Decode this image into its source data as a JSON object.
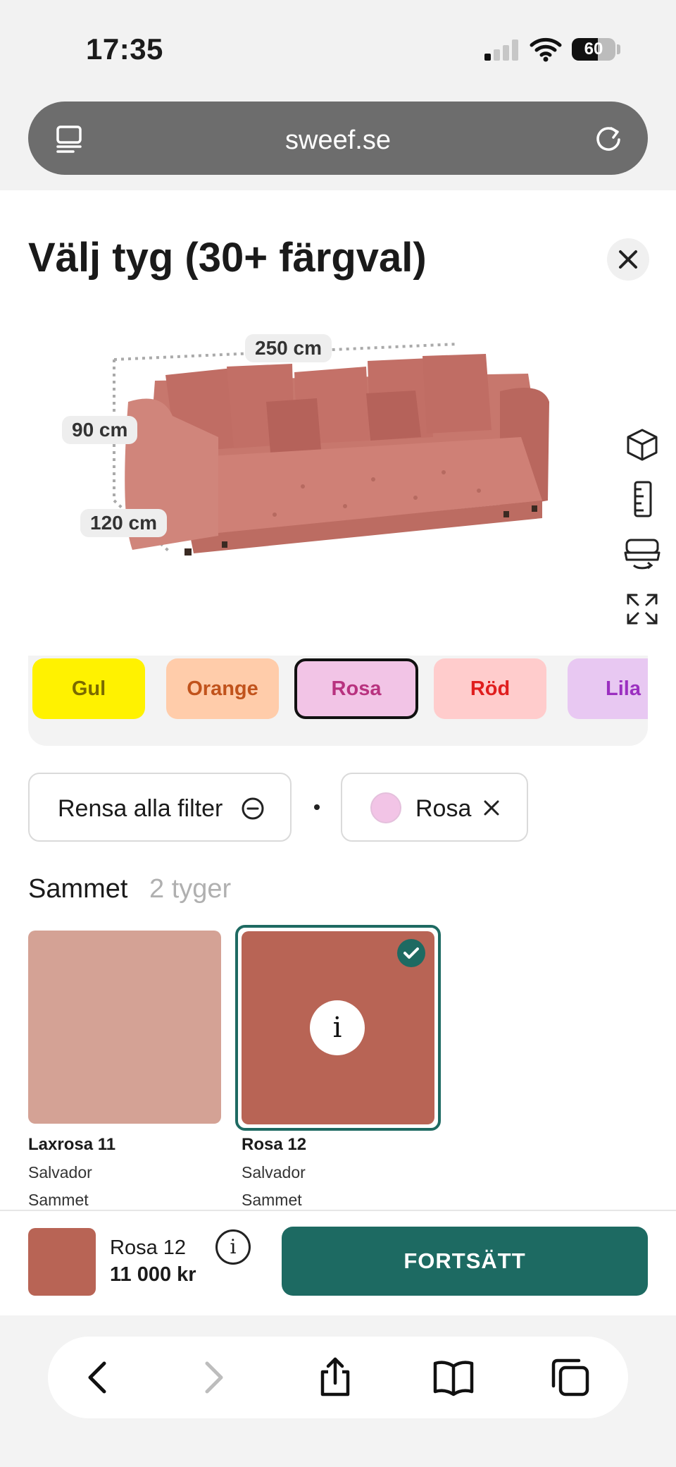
{
  "status": {
    "time": "17:35",
    "battery": "60"
  },
  "browser": {
    "url": "sweef.se"
  },
  "panel": {
    "title": "Välj tyg (30+ färgval)"
  },
  "dimensions": {
    "width": "250 cm",
    "height": "90 cm",
    "depth": "120 cm"
  },
  "colors": {
    "chips": [
      {
        "label": "Gul",
        "bg": "#fff200",
        "fg": "#7a6a00"
      },
      {
        "label": "Orange",
        "bg": "#ffccaa",
        "fg": "#c1531c"
      },
      {
        "label": "Rosa",
        "bg": "#f2c4e6",
        "fg": "#b8327f",
        "selected": true
      },
      {
        "label": "Röd",
        "bg": "#ffcccc",
        "fg": "#e01e1e"
      },
      {
        "label": "Lila",
        "bg": "#e8c8f2",
        "fg": "#9b2fc0"
      }
    ]
  },
  "filters": {
    "clear_label": "Rensa alla filter",
    "active_label": "Rosa",
    "active_color": "#f2c4e6"
  },
  "section": {
    "title": "Sammet",
    "count": "2 tyger"
  },
  "fabrics": [
    {
      "name": "Laxrosa 11",
      "collection": "Salvador",
      "material": "Sammet",
      "color": "#d4a295",
      "selected": false
    },
    {
      "name": "Rosa 12",
      "collection": "Salvador",
      "material": "Sammet",
      "color": "#b86455",
      "selected": true
    }
  ],
  "selection": {
    "name": "Rosa 12",
    "price": "11 000 kr",
    "continue_label": "FORTSÄTT"
  },
  "theme": {
    "accent": "#1d6a62",
    "sofa": "#c97b72"
  }
}
